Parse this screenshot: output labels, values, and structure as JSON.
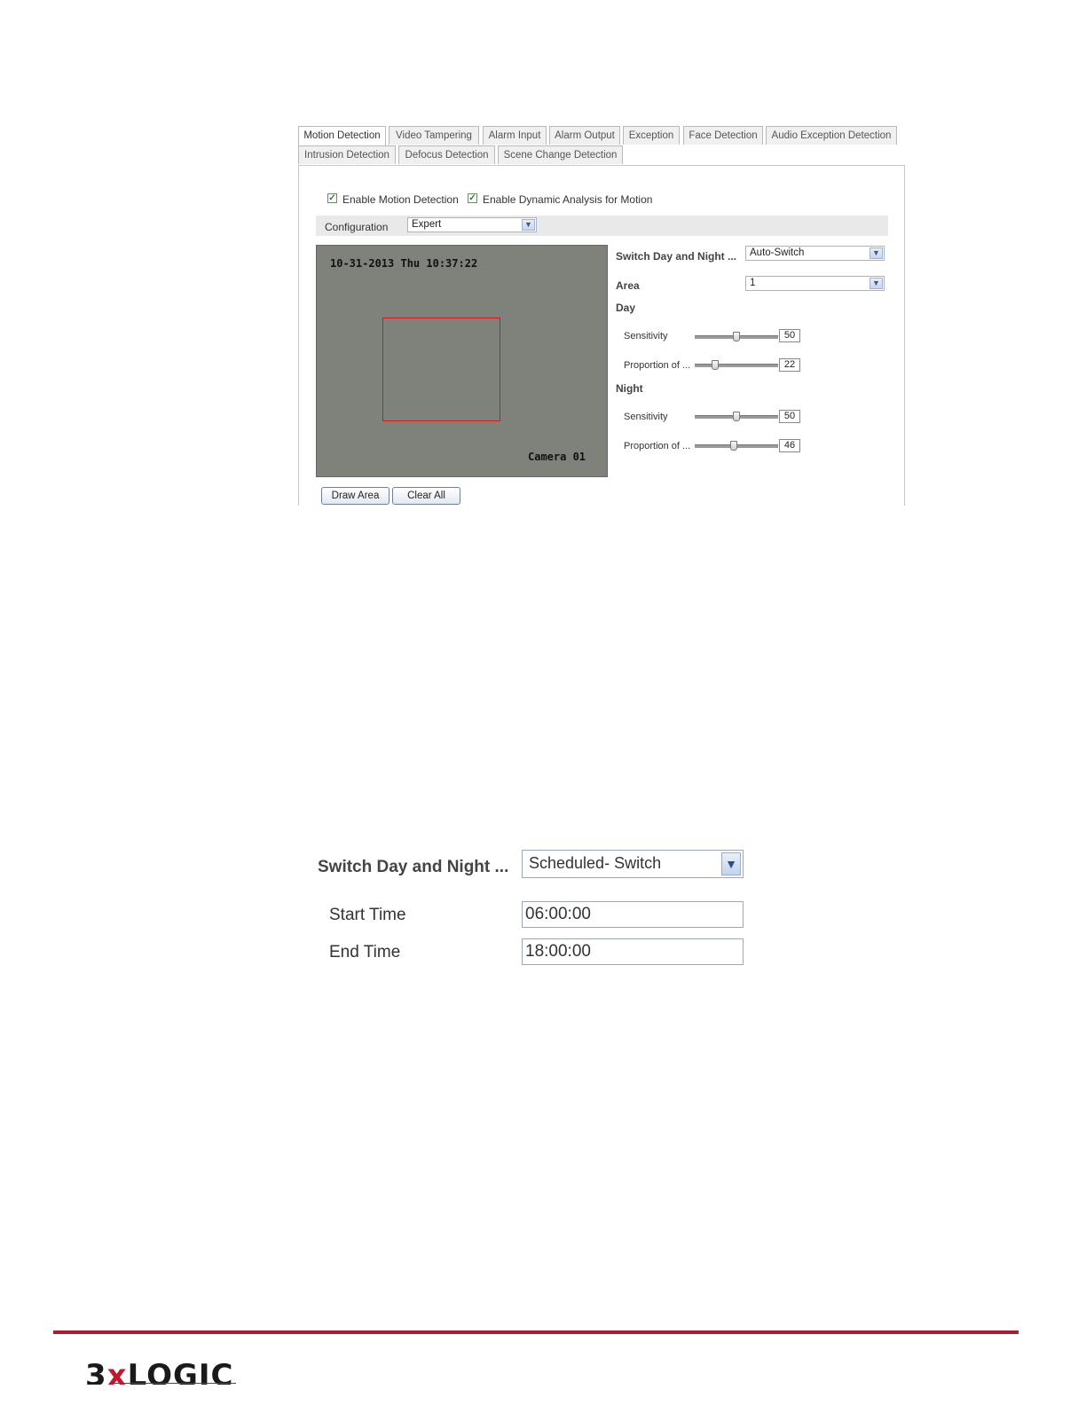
{
  "motion_panel": {
    "tabs_row1": [
      "Motion Detection",
      "Video Tampering",
      "Alarm Input",
      "Alarm Output",
      "Exception",
      "Face Detection",
      "Audio Exception Detection"
    ],
    "tabs_row2": [
      "Intrusion Detection",
      "Defocus Detection",
      "Scene Change Detection"
    ],
    "active_tab": "Motion Detection",
    "enable_motion_label": "Enable Motion Detection",
    "enable_motion_checked": true,
    "enable_dynamic_label": "Enable Dynamic Analysis for Motion",
    "enable_dynamic_checked": true,
    "configuration_label": "Configuration",
    "configuration_value": "Expert",
    "video": {
      "timestamp": "10-31-2013 Thu 10:37:22",
      "camera_name": "Camera 01"
    },
    "switch_label": "Switch Day and Night ...",
    "switch_value": "Auto-Switch",
    "area_label": "Area",
    "area_value": "1",
    "day_label": "Day",
    "night_label": "Night",
    "sensitivity_label": "Sensitivity",
    "proportion_label": "Proportion of ...",
    "day_sensitivity": "50",
    "day_proportion": "22",
    "night_sensitivity": "50",
    "night_proportion": "46",
    "draw_area_label": "Draw Area",
    "clear_all_label": "Clear All"
  },
  "schedule_panel": {
    "switch_label": "Switch Day and Night ...",
    "switch_value": "Scheduled- Switch",
    "start_time_label": "Start Time",
    "start_time_value": "06:00:00",
    "end_time_label": "End Time",
    "end_time_value": "18:00:00"
  },
  "footer": {
    "logo_text_a": "3",
    "logo_text_x": "x",
    "logo_text_b": "LOGIC",
    "accent_color": "#b01a2e"
  }
}
